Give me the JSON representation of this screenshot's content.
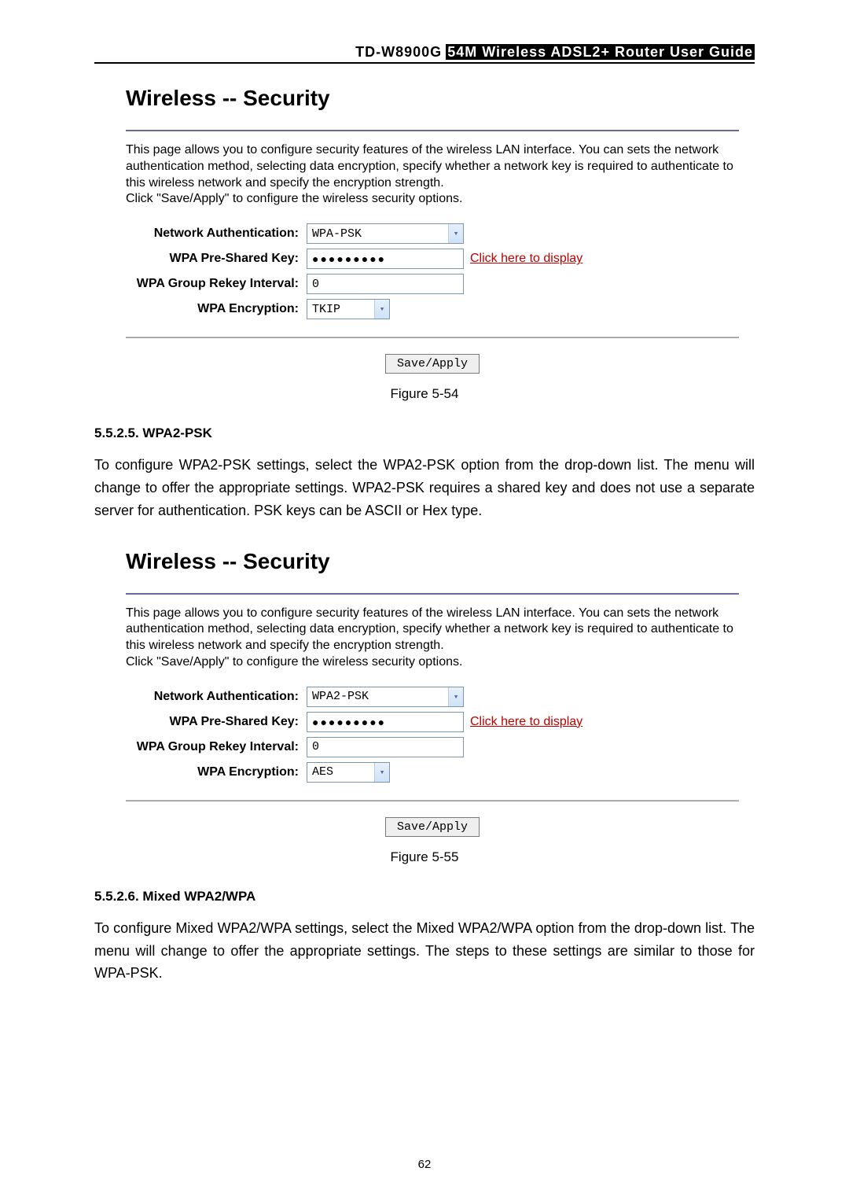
{
  "header": {
    "model": "TD-W8900G",
    "title_rest": " 54M  Wireless  ADSL2+  Router  User  Guide"
  },
  "panel1": {
    "title": "Wireless -- Security",
    "desc": "This page allows you to configure security features of the wireless LAN interface. You can sets the network authentication method, selecting data encryption, specify whether a network key is required to authenticate to this wireless network and specify the encryption strength.\nClick \"Save/Apply\" to configure the wireless security options.",
    "labels": {
      "net_auth": "Network Authentication:",
      "psk": "WPA Pre-Shared Key:",
      "rekey": "WPA Group Rekey Interval:",
      "enc": "WPA Encryption:"
    },
    "values": {
      "net_auth": "WPA-PSK",
      "psk_mask": "●●●●●●●●●",
      "rekey": "0",
      "enc": "TKIP"
    },
    "link": "Click here to display",
    "save": "Save/Apply",
    "figure": "Figure 5-54"
  },
  "section1": {
    "num": "5.5.2.5.   WPA2-PSK",
    "text": "To configure WPA2-PSK settings, select the WPA2-PSK option from the drop-down list. The menu will change to offer the appropriate settings. WPA2-PSK requires a shared key and does not use a separate server for authentication. PSK keys can be ASCII or Hex type."
  },
  "panel2": {
    "title": "Wireless -- Security",
    "desc": "This page allows you to configure security features of the wireless LAN interface. You can sets the network authentication method, selecting data encryption, specify whether a network key is required to authenticate to this wireless network and specify the encryption strength.\nClick \"Save/Apply\" to configure the wireless security options.",
    "labels": {
      "net_auth": "Network Authentication:",
      "psk": "WPA Pre-Shared Key:",
      "rekey": "WPA Group Rekey Interval:",
      "enc": "WPA Encryption:"
    },
    "values": {
      "net_auth": "WPA2-PSK",
      "psk_mask": "●●●●●●●●●",
      "rekey": "0",
      "enc": "AES"
    },
    "link": "Click here to display",
    "save": "Save/Apply",
    "figure": "Figure 5-55"
  },
  "section2": {
    "num": "5.5.2.6.   Mixed WPA2/WPA",
    "text": "To configure Mixed WPA2/WPA settings, select the Mixed WPA2/WPA option from the drop-down list. The menu will change to offer the appropriate settings. The steps to these settings are similar to those for WPA-PSK."
  },
  "page_number": "62"
}
